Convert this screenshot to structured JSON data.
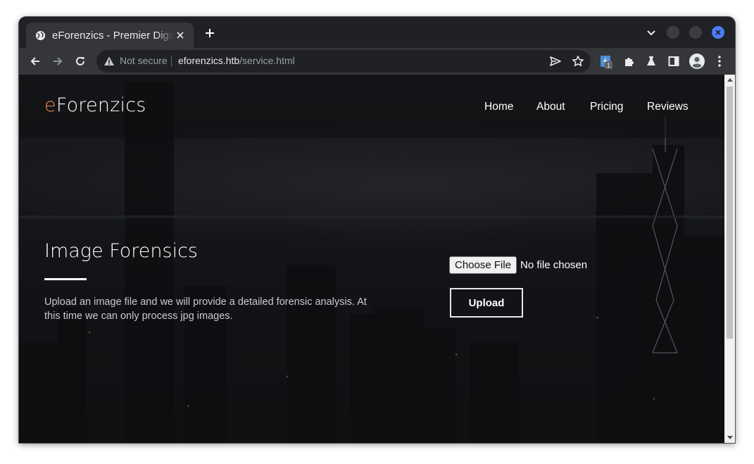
{
  "browser": {
    "tab_title": "eForenzics - Premier Digital Forensics",
    "address": {
      "security_label": "Not secure",
      "domain": "eforenzics.htb",
      "path": "/service.html"
    },
    "extension_badge": "1",
    "icons": {
      "favicon": "globe-icon",
      "close": "close-icon",
      "new_tab": "plus-icon",
      "back": "arrow-left-icon",
      "forward": "arrow-right-icon",
      "reload": "reload-icon",
      "warning": "warning-icon",
      "send": "send-icon",
      "bookmark": "star-icon",
      "extensions": "puzzle-icon",
      "labs": "flask-icon",
      "side_panel": "side-panel-icon",
      "profile": "profile-icon",
      "menu": "kebab-menu-icon"
    },
    "colors": {
      "frame": "#202124",
      "toolbar": "#35363a",
      "close_accent": "#4c7cf6"
    }
  },
  "site": {
    "logo": {
      "accent": "e",
      "rest": "Forenzics"
    },
    "nav": [
      "Home",
      "About",
      "Pricing",
      "Reviews"
    ],
    "hero": {
      "title": "Image Forensics",
      "text": "Upload an image file and we will provide a detailed forensic analysis. At this time we can only process jpg images."
    },
    "form": {
      "choose_file_label": "Choose File",
      "file_status": "No file chosen",
      "upload_label": "Upload"
    },
    "colors": {
      "accent": "#e9874a",
      "text": "#ffffff"
    }
  }
}
